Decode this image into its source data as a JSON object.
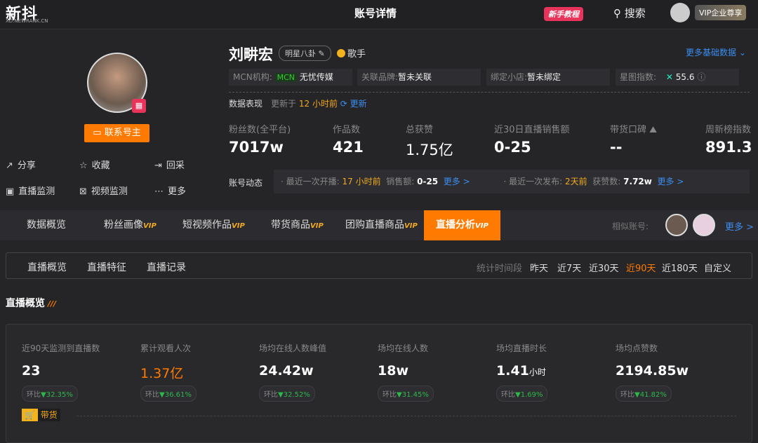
{
  "header": {
    "logo": "新抖",
    "logo_sub": "XD.NEWRANK.CN",
    "title": "账号详情",
    "tutorial": "新手教程",
    "search": "搜索",
    "vip": "VIP企业尊享"
  },
  "profile": {
    "name": "刘畊宏",
    "tag": "明星八卦",
    "category": "歌手",
    "more_basic": "更多基础数据",
    "contact": "联系号主",
    "actions": [
      "分享",
      "收藏",
      "回采",
      "直播监测",
      "视频监测",
      "更多"
    ],
    "info": [
      {
        "label": "MCN机构:",
        "badge": "MCN",
        "value": "无忧传媒"
      },
      {
        "label": "关联品牌:",
        "value": "暂未关联"
      },
      {
        "label": "绑定小店:",
        "value": "暂未绑定"
      },
      {
        "label": "星图指数:",
        "value": "55.6"
      }
    ],
    "perf_label": "数据表现",
    "updated_prefix": "更新于",
    "updated": "12 小时前",
    "refresh": "更新",
    "stats": [
      {
        "label": "粉丝数(全平台)",
        "value": "7017w"
      },
      {
        "label": "作品数",
        "value": "421"
      },
      {
        "label": "总获赞",
        "value": "1.75亿"
      },
      {
        "label": "近30日直播销售额",
        "value": "0-25"
      },
      {
        "label": "带货口碑",
        "value": "--"
      },
      {
        "label": "周新榜指数",
        "value": "891.3"
      }
    ],
    "dynamics": {
      "label": "账号动态",
      "live_label": "· 最近一次开播:",
      "live_time": "17 小时前",
      "sales_label": "销售额:",
      "sales": "0-25",
      "more1": "更多 >",
      "post_label": "· 最近一次发布:",
      "post_time": "2天前",
      "likes_label": "获赞数:",
      "likes": "7.72w",
      "more2": "更多 >"
    }
  },
  "tabs": {
    "items": [
      "数据概览",
      "粉丝画像",
      "短视频作品",
      "带货商品",
      "团购直播商品",
      "直播分析"
    ],
    "vip": "VIP",
    "similar": "相似账号:",
    "more": "更多 >"
  },
  "subtabs": {
    "items": [
      "直播概览",
      "直播特征",
      "直播记录"
    ],
    "period_label": "统计时间段",
    "periods": [
      "昨天",
      "近7天",
      "近30天",
      "近90天",
      "近180天",
      "自定义"
    ]
  },
  "overview": {
    "title": "直播概览",
    "metrics": [
      {
        "label": "近90天监测到直播数",
        "value": "23",
        "change": "32.35%"
      },
      {
        "label": "累计观看人次",
        "value": "1.37亿",
        "change": "36.61%"
      },
      {
        "label": "场均在线人数峰值",
        "value": "24.42w",
        "change": "32.52%"
      },
      {
        "label": "场均在线人数",
        "value": "18w",
        "change": "31.45%"
      },
      {
        "label": "场均直播时长",
        "value": "1.41",
        "unit": "小时",
        "change": "1.69%"
      },
      {
        "label": "场均点赞数",
        "value": "2194.85w",
        "change": "41.82%"
      }
    ],
    "ratio_label": "环比",
    "goods": "带货"
  }
}
